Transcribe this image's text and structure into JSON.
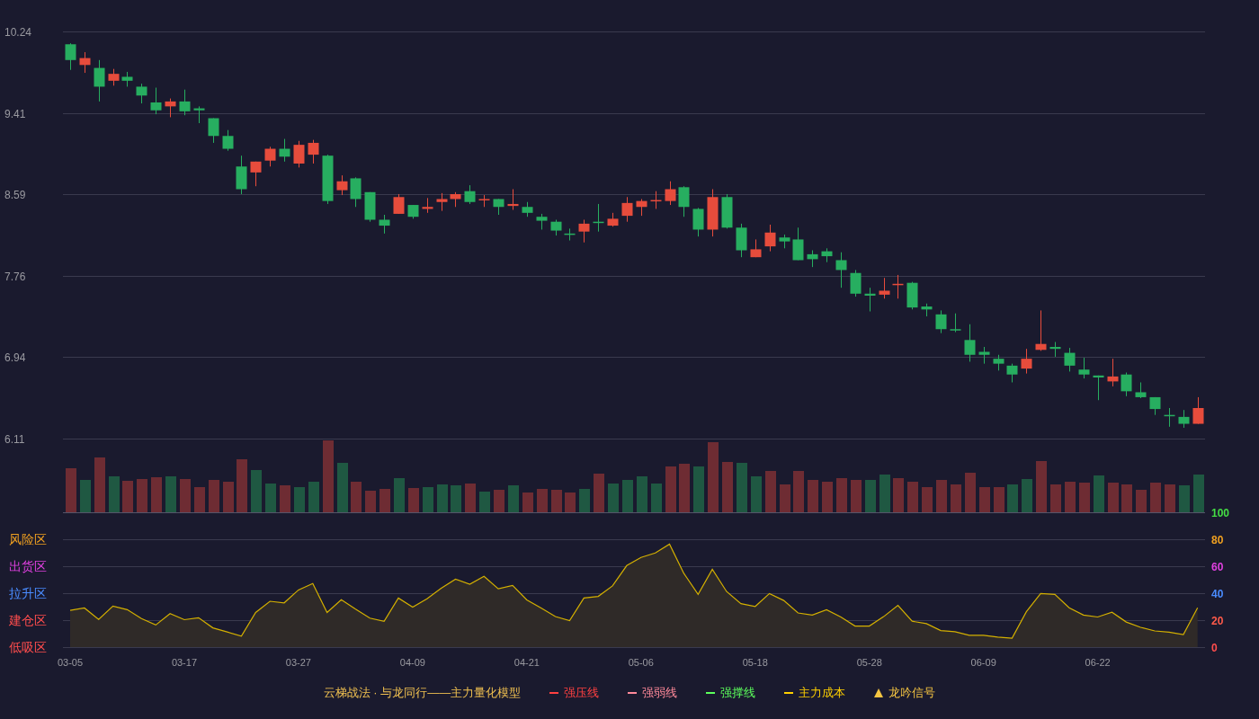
{
  "price_chart": {
    "chart_data": {
      "type": "candlestick",
      "grid": true,
      "ylim": [
        6.11,
        10.24
      ],
      "yticks": [
        10.24,
        9.41,
        8.59,
        7.76,
        6.94,
        6.11
      ],
      "categories": [
        null,
        null,
        null,
        null,
        null,
        null,
        null,
        null,
        null,
        null,
        null,
        null,
        null,
        null,
        null,
        null,
        null,
        null,
        null,
        null,
        null,
        null,
        null,
        null,
        null,
        null,
        null,
        null,
        null,
        null,
        null,
        null,
        null,
        null,
        null,
        null,
        null,
        null,
        null,
        null,
        null,
        null,
        null,
        null,
        null,
        null,
        null,
        null,
        null,
        null,
        null,
        null,
        null,
        null,
        null,
        null,
        null,
        null,
        null,
        null,
        null,
        null,
        null,
        null,
        null,
        null,
        null,
        null,
        null,
        null,
        null,
        null,
        null,
        null,
        null,
        null,
        null,
        null,
        null,
        null
      ],
      "ohlc": [
        [
          10.11,
          10.12,
          9.85,
          9.95
        ],
        [
          9.9,
          10.03,
          9.82,
          9.97
        ],
        [
          9.87,
          9.95,
          9.53,
          9.68
        ],
        [
          9.74,
          9.86,
          9.69,
          9.81
        ],
        [
          9.78,
          9.83,
          9.68,
          9.74
        ],
        [
          9.68,
          9.71,
          9.51,
          9.59
        ],
        [
          9.52,
          9.67,
          9.4,
          9.44
        ],
        [
          9.48,
          9.56,
          9.37,
          9.53
        ],
        [
          9.53,
          9.65,
          9.39,
          9.43
        ],
        [
          9.46,
          9.48,
          9.31,
          9.44
        ],
        [
          9.36,
          9.36,
          9.11,
          9.18
        ],
        [
          9.18,
          9.24,
          9.03,
          9.05
        ],
        [
          8.87,
          8.98,
          8.59,
          8.64
        ],
        [
          8.81,
          8.92,
          8.67,
          8.92
        ],
        [
          8.93,
          9.07,
          8.87,
          9.05
        ],
        [
          9.05,
          9.15,
          8.92,
          8.97
        ],
        [
          8.9,
          9.13,
          8.86,
          9.09
        ],
        [
          8.99,
          9.14,
          8.9,
          9.11
        ],
        [
          8.98,
          8.99,
          8.49,
          8.52
        ],
        [
          8.63,
          8.78,
          8.58,
          8.72
        ],
        [
          8.75,
          8.76,
          8.46,
          8.54
        ],
        [
          8.61,
          8.61,
          8.31,
          8.33
        ],
        [
          8.33,
          8.38,
          8.19,
          8.27
        ],
        [
          8.39,
          8.59,
          8.39,
          8.56
        ],
        [
          8.48,
          8.48,
          8.34,
          8.36
        ],
        [
          8.44,
          8.55,
          8.4,
          8.46
        ],
        [
          8.51,
          8.6,
          8.42,
          8.54
        ],
        [
          8.54,
          8.61,
          8.46,
          8.59
        ],
        [
          8.62,
          8.68,
          8.49,
          8.51
        ],
        [
          8.53,
          8.58,
          8.46,
          8.54
        ],
        [
          8.54,
          8.54,
          8.38,
          8.46
        ],
        [
          8.47,
          8.64,
          8.43,
          8.49
        ],
        [
          8.46,
          8.51,
          8.36,
          8.4
        ],
        [
          8.36,
          8.39,
          8.23,
          8.32
        ],
        [
          8.31,
          8.33,
          8.17,
          8.22
        ],
        [
          8.19,
          8.24,
          8.12,
          8.18
        ],
        [
          8.21,
          8.33,
          8.1,
          8.29
        ],
        [
          8.31,
          8.49,
          8.21,
          8.3
        ],
        [
          8.27,
          8.4,
          8.26,
          8.34
        ],
        [
          8.37,
          8.56,
          8.31,
          8.5
        ],
        [
          8.46,
          8.54,
          8.37,
          8.52
        ],
        [
          8.52,
          8.62,
          8.44,
          8.53
        ],
        [
          8.52,
          8.72,
          8.48,
          8.64
        ],
        [
          8.66,
          8.67,
          8.36,
          8.46
        ],
        [
          8.44,
          8.45,
          8.16,
          8.23
        ],
        [
          8.23,
          8.64,
          8.16,
          8.56
        ],
        [
          8.56,
          8.59,
          8.24,
          8.25
        ],
        [
          8.25,
          8.29,
          7.95,
          8.02
        ],
        [
          7.95,
          8.13,
          7.95,
          8.03
        ],
        [
          8.06,
          8.28,
          8.01,
          8.2
        ],
        [
          8.15,
          8.18,
          8.04,
          8.11
        ],
        [
          8.13,
          8.25,
          7.92,
          7.92
        ],
        [
          7.98,
          8.02,
          7.85,
          7.93
        ],
        [
          8.01,
          8.04,
          7.9,
          7.96
        ],
        [
          7.92,
          8.0,
          7.64,
          7.82
        ],
        [
          7.79,
          7.82,
          7.55,
          7.58
        ],
        [
          7.58,
          7.64,
          7.4,
          7.56
        ],
        [
          7.57,
          7.74,
          7.53,
          7.61
        ],
        [
          7.67,
          7.77,
          7.53,
          7.68
        ],
        [
          7.69,
          7.7,
          7.42,
          7.44
        ],
        [
          7.45,
          7.48,
          7.35,
          7.42
        ],
        [
          7.37,
          7.41,
          7.18,
          7.22
        ],
        [
          7.22,
          7.38,
          7.19,
          7.21
        ],
        [
          7.11,
          7.27,
          6.89,
          6.96
        ],
        [
          6.99,
          7.04,
          6.87,
          6.96
        ],
        [
          6.92,
          6.96,
          6.8,
          6.87
        ],
        [
          6.85,
          6.87,
          6.68,
          6.76
        ],
        [
          6.82,
          7.02,
          6.77,
          6.92
        ],
        [
          7.01,
          7.41,
          7.0,
          7.07
        ],
        [
          7.04,
          7.09,
          6.94,
          7.02
        ],
        [
          6.98,
          7.03,
          6.79,
          6.85
        ],
        [
          6.81,
          6.93,
          6.72,
          6.76
        ],
        [
          6.75,
          6.75,
          6.5,
          6.73
        ],
        [
          6.69,
          6.92,
          6.64,
          6.74
        ],
        [
          6.76,
          6.78,
          6.54,
          6.59
        ],
        [
          6.58,
          6.68,
          6.52,
          6.53
        ],
        [
          6.53,
          6.53,
          6.35,
          6.41
        ],
        [
          6.35,
          6.42,
          6.23,
          6.34
        ],
        [
          6.33,
          6.4,
          6.22,
          6.26
        ],
        [
          6.26,
          6.53,
          6.26,
          6.42
        ]
      ]
    }
  },
  "indicator": {
    "zones": [
      {
        "label": "风险区",
        "color": "#f0a020"
      },
      {
        "label": "出货区",
        "color": "#e040e0"
      },
      {
        "label": "拉升区",
        "color": "#4a8cff"
      },
      {
        "label": "建仓区",
        "color": "#ff4d4d"
      },
      {
        "label": "低吸区",
        "color": "#ff4d4d"
      }
    ],
    "right_axis_ticks": [
      {
        "color": "#44dd44"
      },
      {
        "color": "#f0a020"
      },
      {
        "color": "#e040e0"
      },
      {
        "color": "#4a8cff"
      },
      {
        "color": "#ff5a4a"
      },
      {
        "color": "#ff4d4d"
      }
    ],
    "chart_data": {
      "type": "area",
      "grid": true,
      "ylim": [
        0,
        100
      ],
      "yticks": [
        100,
        80,
        60,
        40,
        20,
        0
      ],
      "categories": [
        "03-05",
        null,
        null,
        null,
        null,
        null,
        null,
        null,
        "03-17",
        null,
        null,
        null,
        null,
        null,
        null,
        null,
        "03-27",
        null,
        null,
        null,
        null,
        null,
        null,
        null,
        "04-09",
        null,
        null,
        null,
        null,
        null,
        null,
        null,
        "04-21",
        null,
        null,
        null,
        null,
        null,
        null,
        null,
        "05-06",
        null,
        null,
        null,
        null,
        null,
        null,
        null,
        "05-18",
        null,
        null,
        null,
        null,
        null,
        null,
        null,
        "05-28",
        null,
        null,
        null,
        null,
        null,
        null,
        null,
        "06-09",
        null,
        null,
        null,
        null,
        null,
        null,
        null,
        "06-22",
        null,
        null,
        null,
        null,
        null,
        null,
        null
      ],
      "series": [
        {
          "color": "#d4b000",
          "values": [
            27.2,
            29.0,
            20.6,
            30.4,
            27.8,
            21.2,
            16.4,
            24.8,
            20.3,
            21.8,
            14.3,
            11.3,
            8.1,
            25.7,
            34.0,
            32.8,
            42.4,
            47.2,
            25.7,
            35.2,
            28.1,
            21.5,
            19.1,
            36.4,
            29.6,
            35.8,
            43.6,
            50.4,
            46.6,
            52.5,
            43.3,
            45.7,
            35.0,
            29.0,
            22.7,
            19.7,
            36.4,
            37.6,
            45.4,
            60.5,
            66.5,
            69.8,
            76.4,
            54.7,
            39.1,
            57.7,
            41.2,
            32.2,
            30.1,
            39.7,
            34.6,
            25.3,
            23.8,
            27.7,
            22.3,
            15.6,
            15.6,
            22.6,
            31.0,
            19.2,
            17.4,
            12.3,
            11.4,
            8.7,
            8.7,
            7.5,
            6.6,
            26.2,
            39.7,
            39.1,
            29.2,
            23.8,
            22.3,
            25.9,
            18.6,
            14.7,
            12.0,
            11.1,
            9.3,
            29.2
          ]
        }
      ]
    }
  },
  "legend": {
    "title": "云梯战法 · 与龙同行——主力量化模型",
    "items": [
      {
        "label": "强压线",
        "kind": "solid",
        "color": "#ff4040"
      },
      {
        "label": "强弱线",
        "kind": "dashed",
        "color": "#ff8a9a"
      },
      {
        "label": "强撑线",
        "kind": "solid",
        "color": "#5cff5c"
      },
      {
        "label": "主力成本",
        "kind": "dashed",
        "color": "#ffd000"
      },
      {
        "label": "龙吟信号",
        "kind": "triangle",
        "color": "#f5c542"
      }
    ]
  }
}
